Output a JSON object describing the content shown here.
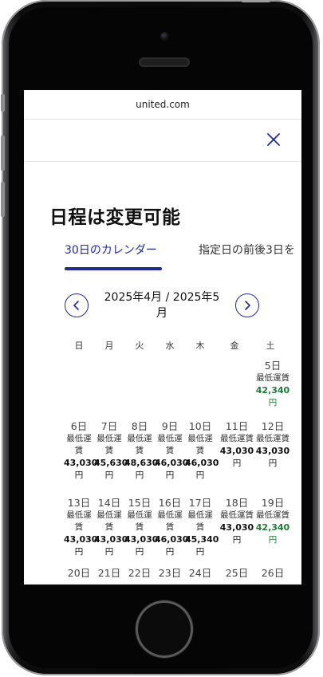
{
  "browser": {
    "url": "united.com"
  },
  "modal": {
    "title": "日程は変更可能",
    "tabs": [
      {
        "label": "30日のカレンダー",
        "active": true
      },
      {
        "label": "指定日の前後3日を"
      }
    ],
    "month_label_line1": "2025年4月 / 2025年5",
    "month_label_line2": "月",
    "weekdays": [
      "日",
      "月",
      "火",
      "水",
      "木",
      "金",
      "土"
    ],
    "accent_color": "#1e2a9c",
    "low_price_color": "#1f7a3a",
    "days": [
      {
        "day": "5日",
        "label": "最低運賃",
        "price": "42,340",
        "unit": "円",
        "lowest": true
      },
      {
        "day": "6日",
        "label": "最低運賃",
        "price": "43,030",
        "unit": "円"
      },
      {
        "day": "7日",
        "label": "最低運賃",
        "price": "45,630",
        "unit": "円"
      },
      {
        "day": "8日",
        "label": "最低運賃",
        "price": "48,630",
        "unit": "円"
      },
      {
        "day": "9日",
        "label": "最低運賃",
        "price": "46,030",
        "unit": "円"
      },
      {
        "day": "10日",
        "label": "最低運賃",
        "price": "46,030",
        "unit": "円"
      },
      {
        "day": "11日",
        "label": "最低運賃",
        "price": "43,030",
        "unit": "円"
      },
      {
        "day": "12日",
        "label": "最低運賃",
        "price": "43,030",
        "unit": "円"
      },
      {
        "day": "13日",
        "label": "最低運賃",
        "price": "43,030",
        "unit": "円"
      },
      {
        "day": "14日",
        "label": "最低運賃",
        "price": "43,030",
        "unit": "円"
      },
      {
        "day": "15日",
        "label": "最低運賃",
        "price": "43,030",
        "unit": "円"
      },
      {
        "day": "16日",
        "label": "最低運賃",
        "price": "46,030",
        "unit": "円"
      },
      {
        "day": "17日",
        "label": "最低運賃",
        "price": "45,340",
        "unit": "円"
      },
      {
        "day": "18日",
        "label": "最低運賃",
        "price": "43,030",
        "unit": "円"
      },
      {
        "day": "19日",
        "label": "最低運賃",
        "price": "42,340",
        "unit": "円",
        "lowest": true
      },
      {
        "day": "20日"
      },
      {
        "day": "21日"
      },
      {
        "day": "22日"
      },
      {
        "day": "23日"
      },
      {
        "day": "24日"
      },
      {
        "day": "25日"
      },
      {
        "day": "26日"
      }
    ]
  }
}
